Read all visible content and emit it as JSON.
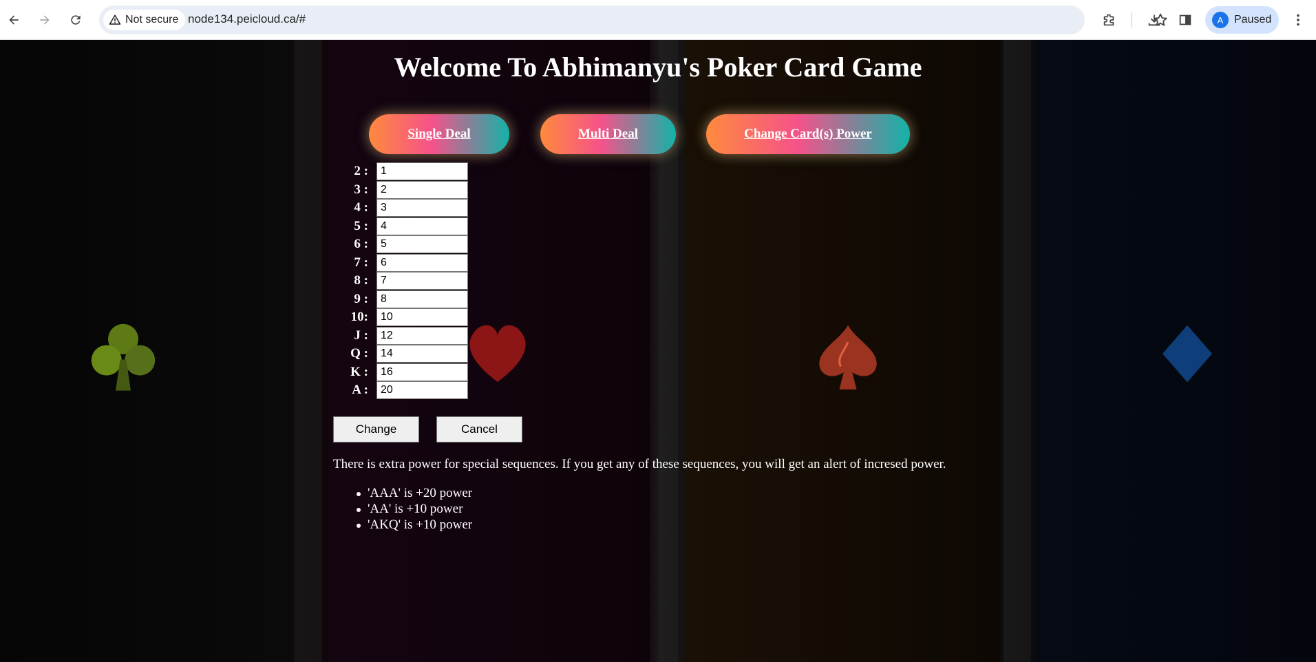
{
  "browser": {
    "security_label": "Not secure",
    "url": "node134.peicloud.ca/#",
    "profile_initial": "A",
    "profile_status": "Paused"
  },
  "page": {
    "title": "Welcome To Abhimanyu's Poker Card Game",
    "nav": {
      "single_deal": "Single Deal",
      "multi_deal": "Multi Deal",
      "change_power": "Change Card(s) Power"
    },
    "card_powers": [
      {
        "label": "2 :",
        "value": "1"
      },
      {
        "label": "3 :",
        "value": "2"
      },
      {
        "label": "4 :",
        "value": "3"
      },
      {
        "label": "5 :",
        "value": "4"
      },
      {
        "label": "6 :",
        "value": "5"
      },
      {
        "label": "7 :",
        "value": "6"
      },
      {
        "label": "8 :",
        "value": "7"
      },
      {
        "label": "9 :",
        "value": "8"
      },
      {
        "label": "10:",
        "value": "10"
      },
      {
        "label": "J :",
        "value": "12"
      },
      {
        "label": "Q :",
        "value": "14"
      },
      {
        "label": "K :",
        "value": "16"
      },
      {
        "label": "A :",
        "value": "20"
      }
    ],
    "buttons": {
      "change": "Change",
      "cancel": "Cancel"
    },
    "info": "There is extra power for special sequences. If you get any of these sequences, you will get an alert of incresed power.",
    "rules": [
      "'AAA' is +20 power",
      "'AA' is +10 power",
      "'AKQ' is +10 power"
    ],
    "suits": [
      "club-icon",
      "heart-icon",
      "spade-icon",
      "diamond-icon"
    ]
  }
}
